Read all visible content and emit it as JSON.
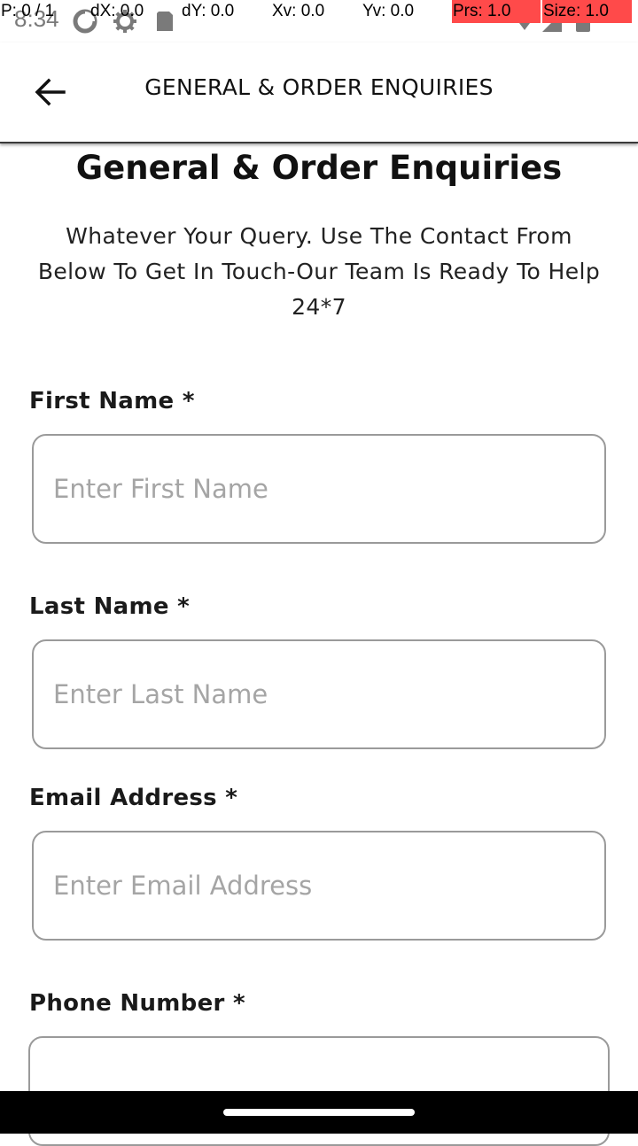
{
  "status_bar": {
    "time": "8:34",
    "overlay": {
      "p": "P: 0 / 1",
      "dx": "dX: 0.0",
      "dy": "dY: 0.0",
      "xv": "Xv: 0.0",
      "yv": "Yv: 0.0",
      "prs": "Prs: 1.0",
      "size": "Size: 1.0"
    }
  },
  "app_bar": {
    "title": "GENERAL & ORDER ENQUIRIES"
  },
  "page": {
    "title": "General & Order Enquiries",
    "intro": "Whatever Your Query. Use The Contact From Below To Get In Touch-Our Team Is Ready To Help 24*7"
  },
  "form": {
    "first_name": {
      "label": "First Name *",
      "placeholder": "Enter First Name",
      "value": ""
    },
    "last_name": {
      "label": "Last Name *",
      "placeholder": "Enter Last Name",
      "value": ""
    },
    "email": {
      "label": "Email Address *",
      "placeholder": "Enter Email Address",
      "value": ""
    },
    "phone": {
      "label": "Phone Number *",
      "placeholder": "",
      "value": ""
    }
  },
  "colors": {
    "overlay_red": "#ff4a4a",
    "input_border": "#9a9a9a",
    "placeholder": "#a5a5a5"
  }
}
